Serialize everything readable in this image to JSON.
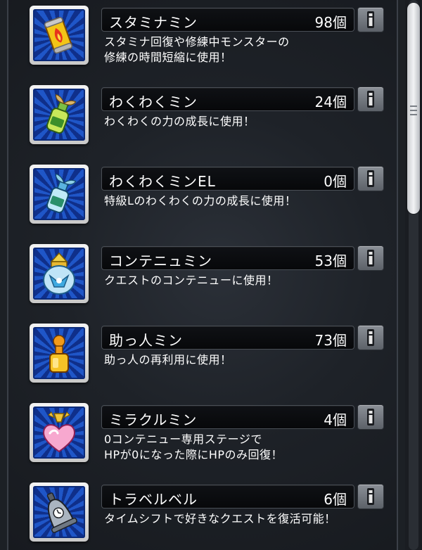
{
  "items": [
    {
      "name": "スタミナミン",
      "count": "98個",
      "desc": "スタミナ回復や修練中モンスターの\n修練の時間短縮に使用！",
      "icon": "stamina-can-icon"
    },
    {
      "name": "わくわくミン",
      "count": "24個",
      "desc": "わくわくの力の成長に使用！",
      "icon": "sprout-bottle-icon"
    },
    {
      "name": "わくわくミンEL",
      "count": "0個",
      "desc": "特級Lのわくわくの力の成長に使用！",
      "icon": "el-sprout-bottle-icon"
    },
    {
      "name": "コンテニュミン",
      "count": "53個",
      "desc": "クエストのコンテニューに使用！",
      "icon": "continue-jar-icon"
    },
    {
      "name": "助っ人ミン",
      "count": "73個",
      "desc": "助っ人の再利用に使用！",
      "icon": "helper-bottle-icon"
    },
    {
      "name": "ミラクルミン",
      "count": "4個",
      "desc": "0コンテニュー専用ステージで\nHPが0になった際にHPのみ回復！",
      "icon": "heart-flask-icon"
    },
    {
      "name": "トラベルベル",
      "count": "6個",
      "desc": "タイムシフトで好きなクエストを復活可能！",
      "icon": "travel-bell-icon"
    }
  ],
  "colors": {
    "icon_bg": "#1f56c8",
    "bar_bg": "#0b0d10",
    "info_button": "#7a7f86"
  },
  "scrollbar": {
    "position_fraction": 0.0,
    "visible_fraction": 0.38
  }
}
